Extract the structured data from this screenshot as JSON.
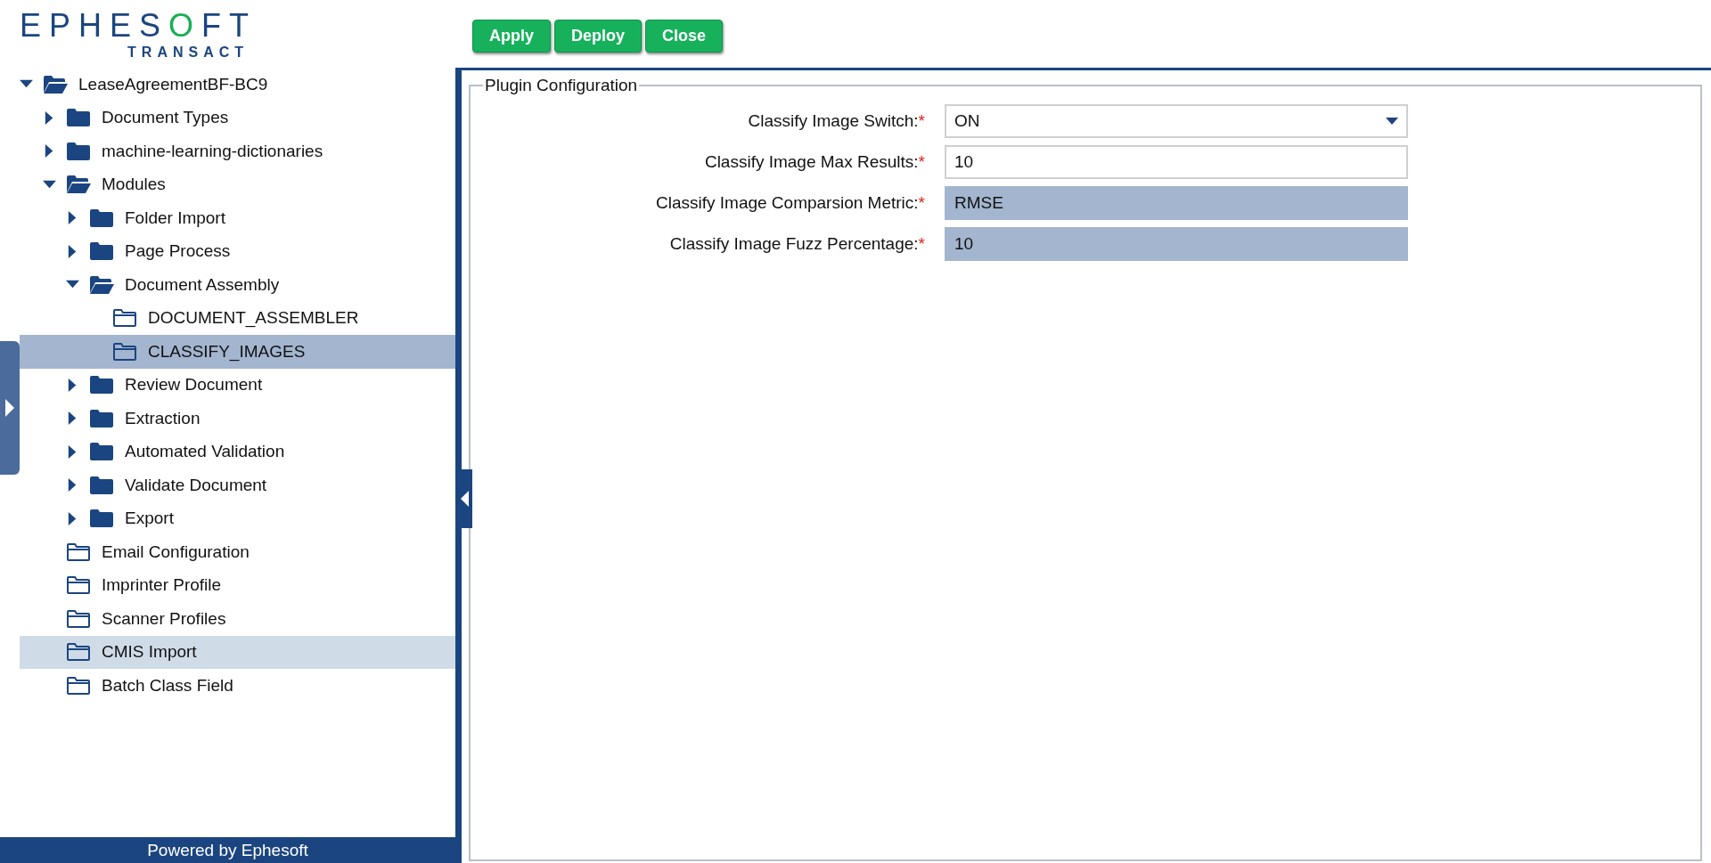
{
  "logo": {
    "wordmark": "EPHESOFT",
    "tagline": "TRANSACT"
  },
  "toolbar": {
    "buttons": [
      "Apply",
      "Deploy",
      "Close"
    ]
  },
  "tree": [
    {
      "label": "LeaseAgreementBF-BC9",
      "kind": "branch",
      "expanded": true,
      "selected": false,
      "hovered": false,
      "children": [
        {
          "label": "Document Types",
          "kind": "branch",
          "expanded": false,
          "selected": false,
          "hovered": false
        },
        {
          "label": "machine-learning-dictionaries",
          "kind": "branch",
          "expanded": false,
          "selected": false,
          "hovered": false
        },
        {
          "label": "Modules",
          "kind": "branch",
          "expanded": true,
          "selected": false,
          "hovered": false,
          "children": [
            {
              "label": "Folder Import",
              "kind": "branch",
              "expanded": false,
              "selected": false,
              "hovered": false
            },
            {
              "label": "Page Process",
              "kind": "branch",
              "expanded": false,
              "selected": false,
              "hovered": false
            },
            {
              "label": "Document Assembly",
              "kind": "branch",
              "expanded": true,
              "selected": false,
              "hovered": false,
              "children": [
                {
                  "label": "DOCUMENT_ASSEMBLER",
                  "kind": "leaf",
                  "selected": false,
                  "hovered": false
                },
                {
                  "label": "CLASSIFY_IMAGES",
                  "kind": "leaf",
                  "selected": true,
                  "hovered": false
                }
              ]
            },
            {
              "label": "Review Document",
              "kind": "branch",
              "expanded": false,
              "selected": false,
              "hovered": false
            },
            {
              "label": "Extraction",
              "kind": "branch",
              "expanded": false,
              "selected": false,
              "hovered": false
            },
            {
              "label": "Automated Validation",
              "kind": "branch",
              "expanded": false,
              "selected": false,
              "hovered": false
            },
            {
              "label": "Validate Document",
              "kind": "branch",
              "expanded": false,
              "selected": false,
              "hovered": false
            },
            {
              "label": "Export",
              "kind": "branch",
              "expanded": false,
              "selected": false,
              "hovered": false
            }
          ]
        },
        {
          "label": "Email Configuration",
          "kind": "leaf",
          "selected": false,
          "hovered": false
        },
        {
          "label": "Imprinter Profile",
          "kind": "leaf",
          "selected": false,
          "hovered": false
        },
        {
          "label": "Scanner Profiles",
          "kind": "leaf",
          "selected": false,
          "hovered": false
        },
        {
          "label": "CMIS Import",
          "kind": "leaf",
          "selected": false,
          "hovered": true
        },
        {
          "label": "Batch Class Field",
          "kind": "leaf",
          "selected": false,
          "hovered": false
        }
      ]
    }
  ],
  "footer": "Powered by Ephesoft",
  "panel": {
    "title": "Plugin Configuration",
    "fields": [
      {
        "label": "Classify Image Switch:",
        "required_mark": "*",
        "kind": "select",
        "value": "ON",
        "disabled": false
      },
      {
        "label": "Classify Image Max Results:",
        "required_mark": "*",
        "kind": "text",
        "value": "10",
        "disabled": false
      },
      {
        "label": "Classify Image Comparsion Metric:",
        "required_mark": "*",
        "kind": "text",
        "value": "RMSE",
        "disabled": true
      },
      {
        "label": "Classify Image Fuzz Percentage:",
        "required_mark": "*",
        "kind": "text",
        "value": "10",
        "disabled": true
      }
    ]
  }
}
